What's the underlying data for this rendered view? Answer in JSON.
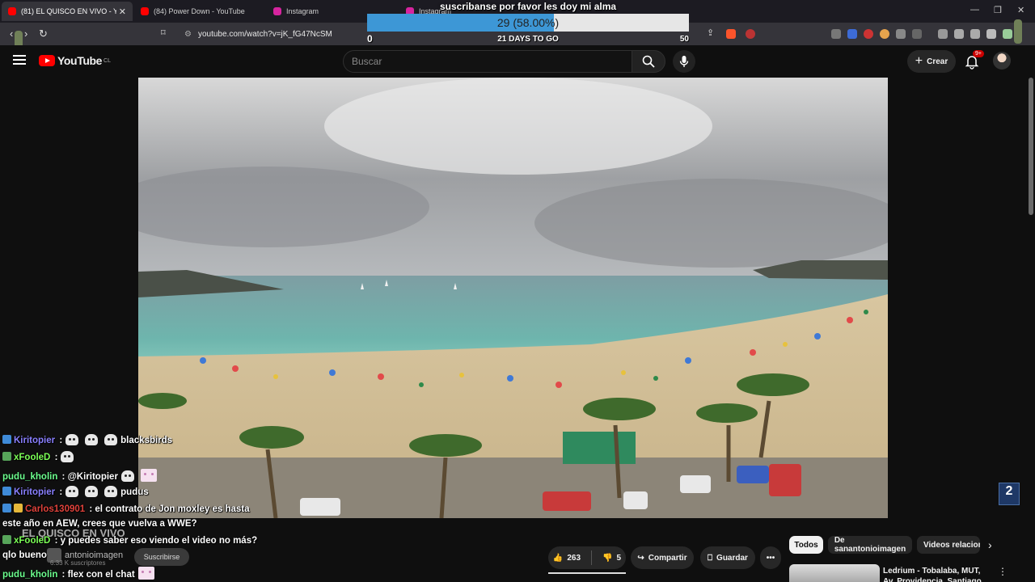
{
  "browser": {
    "tabs": [
      {
        "title": "(81) EL QUISCO EN VIVO - YouTu",
        "active": true,
        "favicon_color": "#ff0000"
      },
      {
        "title": "(84) Power Down - YouTube",
        "active": false,
        "favicon_color": "#ff0000"
      },
      {
        "title": "Instagram",
        "active": false,
        "favicon_color": "#d6249f"
      },
      {
        "title": "Instagram",
        "active": false,
        "favicon_color": "#d6249f"
      }
    ],
    "url": "youtube.com/watch?v=jK_fG47NcSM"
  },
  "youtube": {
    "logo_text": "YouTube",
    "country": "CL",
    "search_placeholder": "Buscar",
    "create_label": "Crear",
    "notifications_badge": "9+"
  },
  "goal_overlay": {
    "title": "suscribanse por favor les doy mi alma",
    "progress_text": "29 (58.00%)",
    "progress_fraction": 0.58,
    "min": "0",
    "max": "50",
    "days_left": "21 DAYS TO GO"
  },
  "video_overlay": {
    "channel_logo": "2"
  },
  "video_info": {
    "title": "EL QUISCO EN VIVO",
    "channel": "antonioimagen",
    "subscribers": "6.33 K suscriptores",
    "subscribe_label": "Suscribirse",
    "likes": "263",
    "dislikes": "5",
    "share_label": "Compartir",
    "save_label": "Guardar"
  },
  "related": {
    "chips": [
      "Todos",
      "De sanantonioimagen",
      "Videos relacion"
    ],
    "first_title": "Ledrium - Tobalaba, MUT, Av. Providencia, Santiago, Chile"
  },
  "chat": [
    {
      "user": "Kiritopier",
      "color": "#8a80ff",
      "text": "blacksbirds",
      "emotes": 3
    },
    {
      "user": "xFooleD",
      "color": "#7cff57",
      "text": "",
      "emotes": 1
    },
    {
      "user": "pudu_kholin",
      "color": "#6dff8f",
      "text": "@Kiritopier",
      "emotes": 2
    },
    {
      "user": "Kiritopier",
      "color": "#8a80ff",
      "text": "pudus",
      "emotes": 3
    },
    {
      "user": "Carlos130901",
      "color": "#e0423b",
      "text": "el contrato de Jon moxley es hasta",
      "emotes": 0
    },
    {
      "user": "",
      "color": "#ffffff",
      "text": "este año en AEW, crees que vuelva a WWE?",
      "emotes": 0
    },
    {
      "user": "xFooleD",
      "color": "#7cff57",
      "text": "y puedes saber eso viendo el video no más?",
      "emotes": 0
    },
    {
      "user": "",
      "color": "#ffffff",
      "text": "qlo bueno",
      "emotes": 0
    },
    {
      "user": "pudu_kholin",
      "color": "#6dff8f",
      "text": "flex con el chat",
      "emotes": 1
    }
  ]
}
